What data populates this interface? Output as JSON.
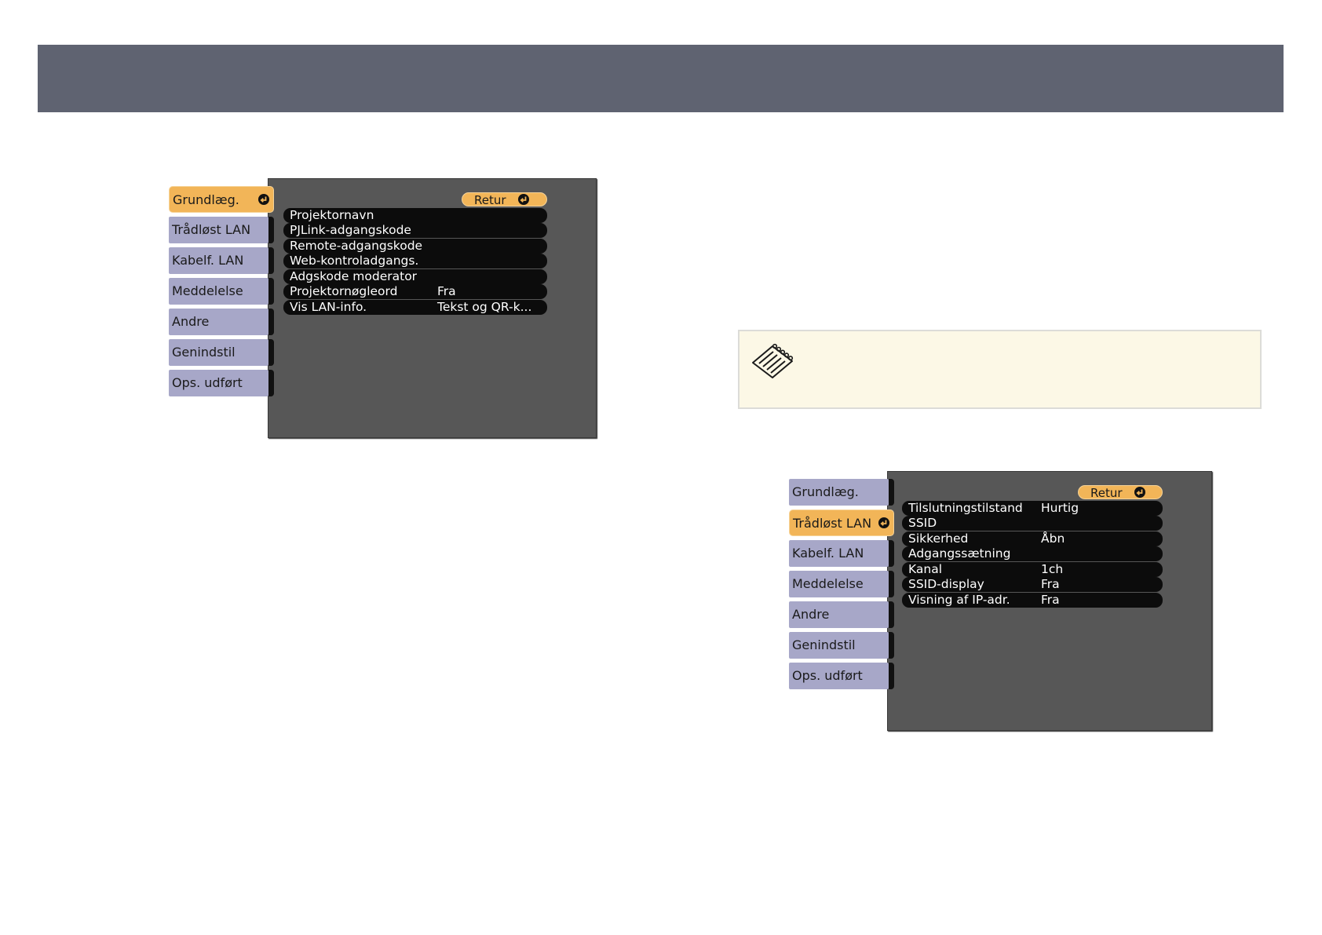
{
  "menu_basic": {
    "sidebar": [
      {
        "label": "Grundlæg.",
        "active": true
      },
      {
        "label": "Trådløst LAN",
        "active": false
      },
      {
        "label": "Kabelf. LAN",
        "active": false
      },
      {
        "label": "Meddelelse",
        "active": false
      },
      {
        "label": "Andre",
        "active": false
      },
      {
        "label": "Genindstil",
        "active": false
      },
      {
        "label": "Ops. udført",
        "active": false
      }
    ],
    "retur_label": "Retur",
    "rows": [
      {
        "label": "Projektornavn",
        "value": ""
      },
      {
        "label": "PJLink-adgangskode",
        "value": ""
      },
      {
        "label": "Remote-adgangskode",
        "value": ""
      },
      {
        "label": "Web-kontroladgangs.",
        "value": ""
      },
      {
        "label": "Adgskode moderator",
        "value": ""
      },
      {
        "label": "Projektornøgleord",
        "value": "Fra"
      },
      {
        "label": "Vis LAN-info.",
        "value": "Tekst og QR-k..."
      }
    ]
  },
  "menu_wireless": {
    "sidebar": [
      {
        "label": "Grundlæg.",
        "active": false
      },
      {
        "label": "Trådløst LAN",
        "active": true
      },
      {
        "label": "Kabelf. LAN",
        "active": false
      },
      {
        "label": "Meddelelse",
        "active": false
      },
      {
        "label": "Andre",
        "active": false
      },
      {
        "label": "Genindstil",
        "active": false
      },
      {
        "label": "Ops. udført",
        "active": false
      }
    ],
    "retur_label": "Retur",
    "rows": [
      {
        "label": "Tilslutningstilstand",
        "value": "Hurtig"
      },
      {
        "label": "SSID",
        "value": ""
      },
      {
        "label": "Sikkerhed",
        "value": "Åbn"
      },
      {
        "label": "Adgangssætning",
        "value": ""
      },
      {
        "label": "Kanal",
        "value": "1ch"
      },
      {
        "label": "SSID-display",
        "value": "Fra"
      },
      {
        "label": "Visning af IP-adr.",
        "value": "Fra"
      }
    ]
  },
  "colors": {
    "header_band": "#5f6371",
    "panel": "#575757",
    "sidebar_item": "#a7a7c8",
    "active_item": "#f2b558",
    "row": "#0c0c0c",
    "note_bg": "#fcf8e6"
  },
  "icons": {
    "enter": "enter-icon",
    "note": "notepad-icon"
  }
}
